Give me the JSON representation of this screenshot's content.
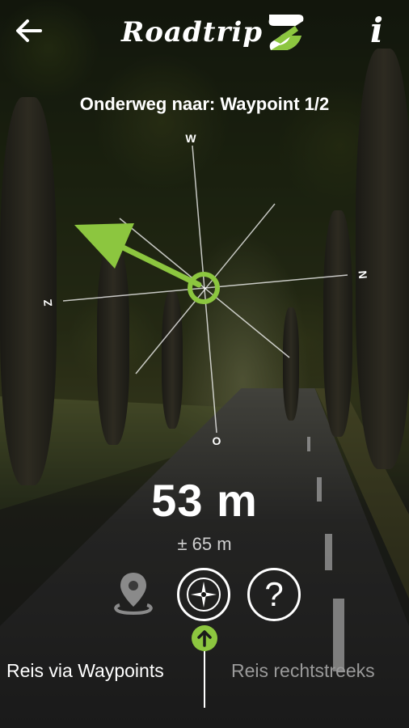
{
  "header": {
    "back_icon": "arrow-left-icon",
    "logo_text": "Roadtrip",
    "logo_mark_icon": "roadtrip-logo-mark",
    "info_label": "i"
  },
  "destination": "Onderweg naar: Waypoint 1/2",
  "compass": {
    "north_label": "N",
    "east_label": "O",
    "south_label": "Z",
    "west_label": "W",
    "arrow_color": "#8cc63f"
  },
  "distance": "53 m",
  "accuracy": "± 65 m",
  "modes": {
    "map_icon": "map-pin-icon",
    "compass_icon": "compass-icon",
    "help_label": "?"
  },
  "tabs": {
    "left": "Reis via Waypoints",
    "right": "Reis rechtstreeks"
  },
  "colors": {
    "accent": "#8cc63f",
    "inactive_text": "#9a9a9a"
  }
}
